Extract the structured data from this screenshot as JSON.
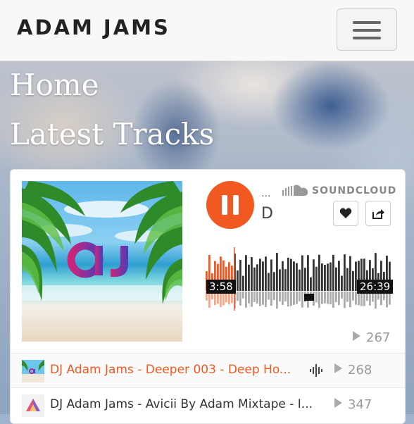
{
  "navbar": {
    "brand": "ADAM JAMS",
    "menu_icon": "hamburger-icon"
  },
  "page": {
    "heading": "Home",
    "subheading": "Latest Tracks"
  },
  "player": {
    "track_ellipsis": "...",
    "track_title": "D",
    "brand_label": "SOUNDCLOUD",
    "current_time": "3:58",
    "duration": "26:39",
    "play_count": "267",
    "progress": 0.15,
    "accent_color": "#f05a22",
    "icons": {
      "pause": "pause-icon",
      "logo": "soundcloud-logo-icon",
      "like": "heart-icon",
      "share": "share-icon",
      "play_count": "play-count-icon"
    }
  },
  "playlist": [
    {
      "title": "DJ Adam Jams - Deeper 003 - Deep Ho...",
      "plays": "268",
      "active": true,
      "icon": "waveform-icon"
    },
    {
      "title": "DJ Adam Jams - Avicii By Adam Mixtape - I...",
      "plays": "347",
      "active": false
    }
  ]
}
